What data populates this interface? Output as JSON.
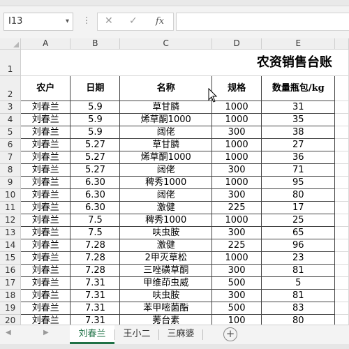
{
  "formula_bar": {
    "name_box": "I13",
    "name_box_dropdown_icon": "chevron-down-icon",
    "cancel_icon": "close-icon",
    "enter_icon": "check-icon",
    "fx_label": "fx",
    "formula_value": ""
  },
  "columns": [
    "A",
    "B",
    "C",
    "D",
    "E"
  ],
  "title": "农资销售台账",
  "headers": [
    "农户",
    "日期",
    "名称",
    "规格",
    "数量瓶包/kg"
  ],
  "rows": [
    {
      "r": "3",
      "farmer": "刘春兰",
      "date": "5.9",
      "name": "草甘膦",
      "spec": "1000",
      "qty": "31"
    },
    {
      "r": "4",
      "farmer": "刘春兰",
      "date": "5.9",
      "name": "烯草酮1000",
      "spec": "1000",
      "qty": "35"
    },
    {
      "r": "5",
      "farmer": "刘春兰",
      "date": "5.9",
      "name": "阔佬",
      "spec": "300",
      "qty": "38"
    },
    {
      "r": "6",
      "farmer": "刘春兰",
      "date": "5.27",
      "name": "草甘膦",
      "spec": "1000",
      "qty": "27"
    },
    {
      "r": "7",
      "farmer": "刘春兰",
      "date": "5.27",
      "name": "烯草酮1000",
      "spec": "1000",
      "qty": "36"
    },
    {
      "r": "8",
      "farmer": "刘春兰",
      "date": "5.27",
      "name": "阔佬",
      "spec": "300",
      "qty": "71"
    },
    {
      "r": "9",
      "farmer": "刘春兰",
      "date": "6.30",
      "name": "稗秀1000",
      "spec": "1000",
      "qty": "95"
    },
    {
      "r": "10",
      "farmer": "刘春兰",
      "date": "6.30",
      "name": "阔佬",
      "spec": "300",
      "qty": "80"
    },
    {
      "r": "11",
      "farmer": "刘春兰",
      "date": "6.30",
      "name": "激健",
      "spec": "225",
      "qty": "17"
    },
    {
      "r": "12",
      "farmer": "刘春兰",
      "date": "7.5",
      "name": "稗秀1000",
      "spec": "1000",
      "qty": "25"
    },
    {
      "r": "13",
      "farmer": "刘春兰",
      "date": "7.5",
      "name": "呋虫胺",
      "spec": "300",
      "qty": "65"
    },
    {
      "r": "14",
      "farmer": "刘春兰",
      "date": "7.28",
      "name": "激健",
      "spec": "225",
      "qty": "96"
    },
    {
      "r": "15",
      "farmer": "刘春兰",
      "date": "7.28",
      "name": "2甲灭草松",
      "spec": "1000",
      "qty": "23"
    },
    {
      "r": "16",
      "farmer": "刘春兰",
      "date": "7.28",
      "name": "三唑磺草酮",
      "spec": "300",
      "qty": "81"
    },
    {
      "r": "17",
      "farmer": "刘春兰",
      "date": "7.31",
      "name": "甲维茚虫威",
      "spec": "500",
      "qty": "5"
    },
    {
      "r": "18",
      "farmer": "刘春兰",
      "date": "7.31",
      "name": "呋虫胺",
      "spec": "300",
      "qty": "81"
    },
    {
      "r": "19",
      "farmer": "刘春兰",
      "date": "7.31",
      "name": "苯甲嘧菌酯",
      "spec": "500",
      "qty": "83"
    },
    {
      "r": "20",
      "farmer": "刘春兰",
      "date": "7.31",
      "name": "莠台素",
      "spec": "100",
      "qty": "80"
    }
  ],
  "row_heads_top": [
    "1",
    "2"
  ],
  "sheet_tabs": {
    "tabs": [
      "刘春兰",
      "王小二",
      "三麻婆"
    ],
    "active": "刘春兰",
    "add_icon": "plus-icon",
    "prev_icon": "triangle-left-icon",
    "next_icon": "triangle-right-icon"
  },
  "colors": {
    "accent": "#1e7145",
    "grid_line": "#d9d9d9",
    "header_bg": "#efefef"
  }
}
